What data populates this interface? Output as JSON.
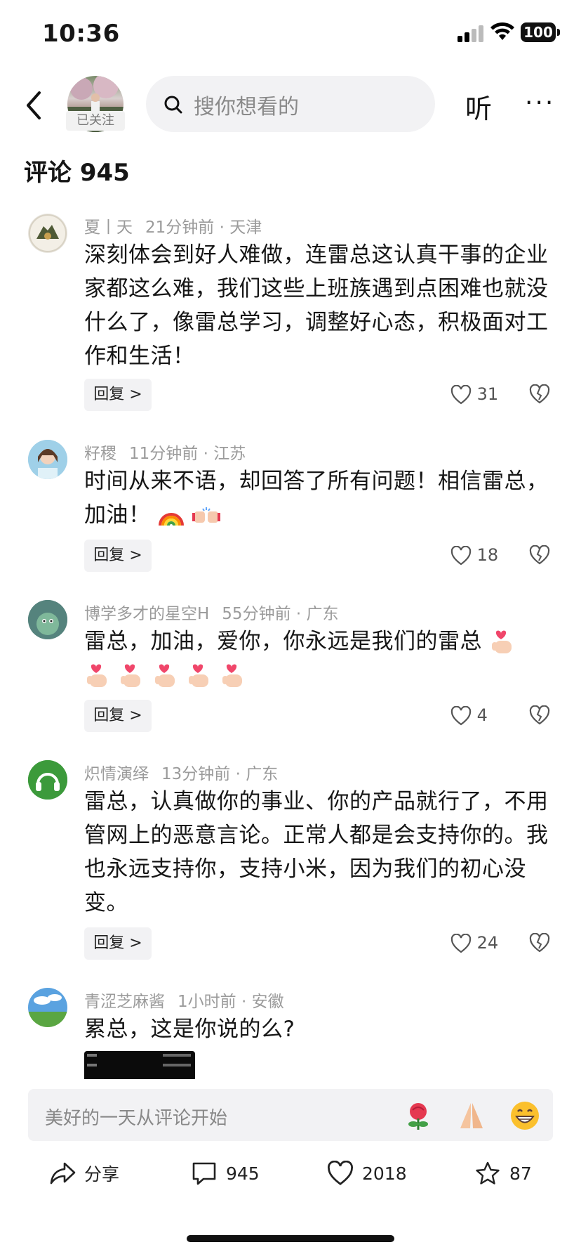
{
  "status": {
    "time": "10:36",
    "battery": "100"
  },
  "header": {
    "followed_label": "已关注",
    "search_placeholder": "搜你想看的",
    "listen_label": "听",
    "more_label": "···"
  },
  "comments_header": {
    "title": "评论 945"
  },
  "comments": [
    {
      "user": "夏丨天",
      "time": "21分钟前",
      "location": "天津",
      "text": "深刻体会到好人难做，连雷总这认真干事的企业家都这么难，我们这些上班族遇到点困难也就没什么了，像雷总学习，调整好心态，积极面对工作和生活！",
      "likes": "31",
      "avatar_color": "#5f6a3c"
    },
    {
      "user": "籽稷",
      "time": "11分钟前",
      "location": "江苏",
      "text": "时间从来不语，却回答了所有问题！相信雷总，加油！",
      "likes": "18",
      "avatar_color": "#8cc4dc",
      "emojis": [
        "rainbow-emoji",
        "fist-bump-emoji"
      ]
    },
    {
      "user": "博学多才的星空H",
      "time": "55分钟前",
      "location": "广东",
      "text": "雷总，加油，爱你，你永远是我们的雷总",
      "likes": "4",
      "avatar_color": "#4f7f7a",
      "emojis": [
        "finger-heart-emoji",
        "finger-heart-emoji",
        "finger-heart-emoji",
        "finger-heart-emoji",
        "finger-heart-emoji",
        "finger-heart-emoji"
      ]
    },
    {
      "user": "炽情演绎",
      "time": "13分钟前",
      "location": "广东",
      "text": "雷总，认真做你的事业、你的产品就行了，不用管网上的恶意言论。正常人都是会支持你的。我也永远支持你，支持小米，因为我们的初心没变。",
      "likes": "24",
      "avatar_color": "#3b9a3a"
    },
    {
      "user": "青涩芝麻酱",
      "time": "1小时前",
      "location": "安徽",
      "text": "累总，这是你说的么?",
      "avatar_color": "#4f93d6"
    }
  ],
  "reply_label": "回复 >",
  "input": {
    "placeholder": "美好的一天从评论开始",
    "quick_emojis": [
      "rose-emoji",
      "pray-emoji",
      "grin-emoji"
    ]
  },
  "bottom_actions": {
    "share_label": "分享",
    "comment_count": "945",
    "like_count": "2018",
    "favorite_count": "87"
  }
}
